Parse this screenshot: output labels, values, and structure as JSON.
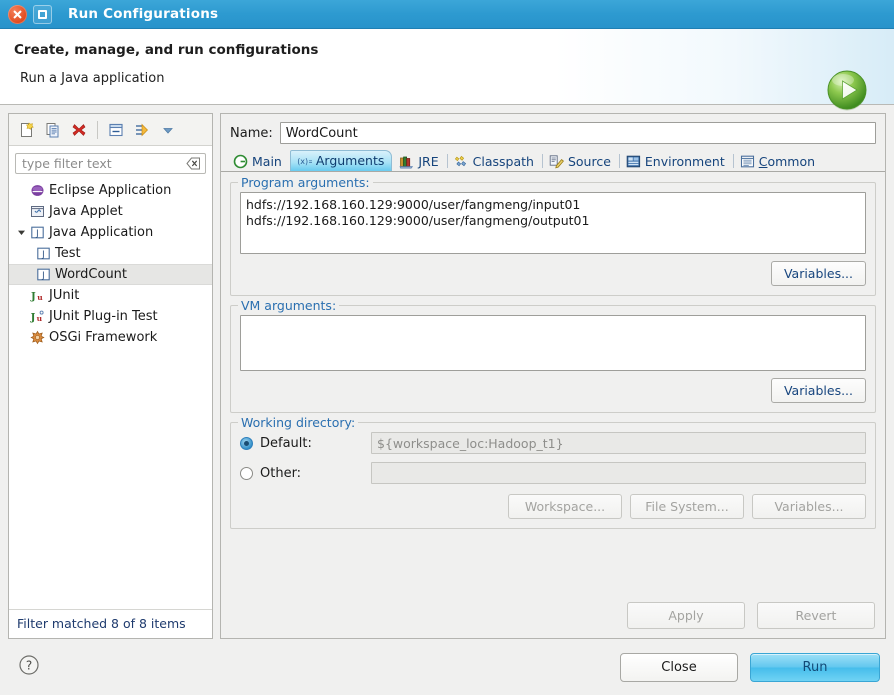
{
  "window": {
    "title": "Run Configurations",
    "close_icon": "close-icon",
    "maximize_icon": "maximize-icon"
  },
  "banner": {
    "title": "Create, manage, and run configurations",
    "subtitle": "Run a Java application",
    "icon": "run-green-play-icon"
  },
  "left_panel": {
    "toolbar": [
      {
        "name": "new-launch-configuration-button",
        "icon": "new-document-icon"
      },
      {
        "name": "duplicate-launch-configuration-button",
        "icon": "copy-document-icon"
      },
      {
        "name": "delete-launch-configuration-button",
        "icon": "delete-red-x-icon"
      },
      {
        "name": "collapse-all-button",
        "icon": "collapse-all-icon"
      },
      {
        "name": "filter-launch-configurations-button",
        "icon": "filter-arrows-icon"
      },
      {
        "name": "view-menu-button",
        "icon": "chevron-down-icon"
      }
    ],
    "filter": {
      "placeholder": "type filter text",
      "value": "",
      "clear_icon": "clear-filter-icon"
    },
    "tree": [
      {
        "label": "Eclipse Application",
        "icon": "eclipse-purple-circle-icon",
        "level": 0,
        "expandable": false,
        "selected": false
      },
      {
        "label": "Java Applet",
        "icon": "java-applet-icon",
        "level": 0,
        "expandable": false,
        "selected": false
      },
      {
        "label": "Java Application",
        "icon": "java-application-icon",
        "level": 0,
        "expandable": true,
        "expanded": true,
        "selected": false
      },
      {
        "label": "Test",
        "icon": "java-application-icon",
        "level": 1,
        "expandable": false,
        "selected": false
      },
      {
        "label": "WordCount",
        "icon": "java-application-icon",
        "level": 1,
        "expandable": false,
        "selected": true
      },
      {
        "label": "JUnit",
        "icon": "junit-icon",
        "level": 0,
        "expandable": false,
        "selected": false
      },
      {
        "label": "JUnit Plug-in Test",
        "icon": "junit-plugin-icon",
        "level": 0,
        "expandable": false,
        "selected": false
      },
      {
        "label": "OSGi Framework",
        "icon": "osgi-icon",
        "level": 0,
        "expandable": false,
        "selected": false
      }
    ],
    "status": "Filter matched 8 of 8 items"
  },
  "right_panel": {
    "name_label": "Name:",
    "name_value": "WordCount",
    "tabs": [
      {
        "label": "Main",
        "icon": "main-green-circle-icon",
        "active": false,
        "mnemonic": ""
      },
      {
        "label": "Arguments",
        "icon": "arguments-icon",
        "active": true,
        "mnemonic": ""
      },
      {
        "label": "JRE",
        "icon": "jre-books-icon",
        "active": false,
        "mnemonic": ""
      },
      {
        "label": "Classpath",
        "icon": "classpath-icon",
        "active": false,
        "mnemonic": ""
      },
      {
        "label": "Source",
        "icon": "source-pencil-icon",
        "active": false,
        "mnemonic": ""
      },
      {
        "label": "Environment",
        "icon": "environment-icon",
        "active": false,
        "mnemonic": ""
      },
      {
        "label": "Common",
        "icon": "common-list-icon",
        "active": false,
        "mnemonic": "C"
      }
    ],
    "program_arguments": {
      "label": "Program arguments:",
      "value": "hdfs://192.168.160.129:9000/user/fangmeng/input01 hdfs://192.168.160.129:9000/user/fangmeng/output01",
      "variables_button": "Variables..."
    },
    "vm_arguments": {
      "label": "VM arguments:",
      "value": "",
      "variables_button": "Variables..."
    },
    "working_directory": {
      "label": "Working directory:",
      "default_label": "Default:",
      "default_value": "${workspace_loc:Hadoop_t1}",
      "default_selected": true,
      "other_label": "Other:",
      "other_value": "",
      "other_selected": false,
      "workspace_button": "Workspace...",
      "file_system_button": "File System...",
      "variables_button": "Variables..."
    },
    "apply_button": "Apply",
    "revert_button": "Revert"
  },
  "footer": {
    "help_icon": "help-question-icon",
    "close_button": "Close",
    "run_button": "Run"
  },
  "colors": {
    "titlebar": "#2d9ad0",
    "accent_tab": "#6ecdf0",
    "run_button": "#46bdeb",
    "group_label": "#2a6fb0",
    "link_text": "#17457e",
    "status_text": "#1f3b6e"
  }
}
